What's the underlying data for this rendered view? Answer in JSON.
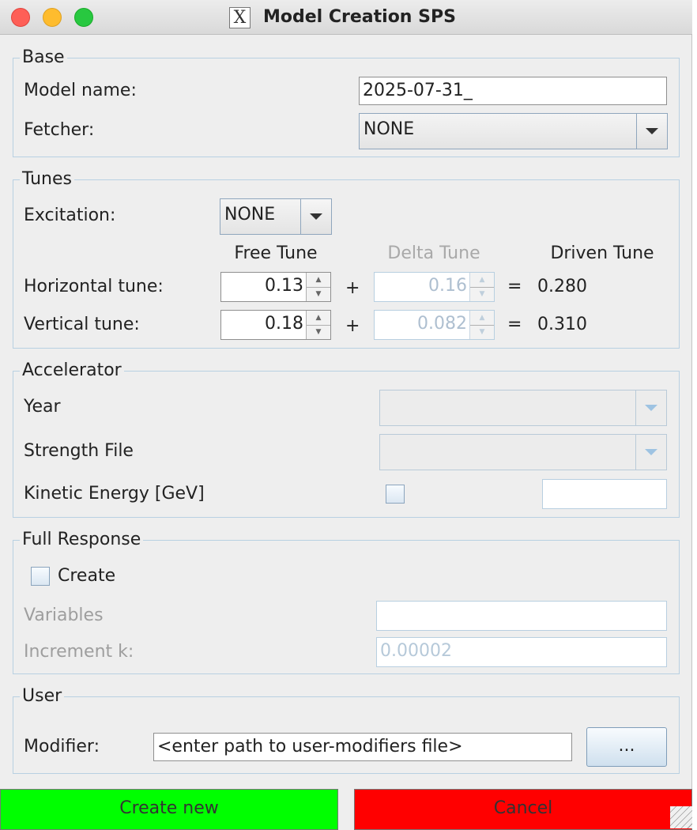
{
  "window": {
    "title": "Model Creation SPS"
  },
  "base": {
    "legend": "Base",
    "model_name_label": "Model name:",
    "model_name_value": "2025-07-31_",
    "fetcher_label": "Fetcher:",
    "fetcher_value": "NONE"
  },
  "tunes": {
    "legend": "Tunes",
    "excitation_label": "Excitation:",
    "excitation_value": "NONE",
    "col_free": "Free Tune",
    "col_delta": "Delta Tune",
    "col_driven": "Driven Tune",
    "plus": "+",
    "equals": "=",
    "horizontal": {
      "label": "Horizontal tune:",
      "free": "0.13",
      "delta": "0.16",
      "driven": "0.280"
    },
    "vertical": {
      "label": "Vertical tune:",
      "free": "0.18",
      "delta": "0.082",
      "driven": "0.310"
    }
  },
  "accelerator": {
    "legend": "Accelerator",
    "year_label": "Year",
    "year_value": "",
    "strength_label": "Strength File",
    "strength_value": "",
    "energy_label": "Kinetic Energy [GeV]",
    "energy_checked": false,
    "energy_value": ""
  },
  "full_response": {
    "legend": "Full Response",
    "create_label": "Create",
    "create_checked": false,
    "variables_label": "Variables",
    "variables_value": "",
    "increment_label": "Increment k:",
    "increment_value": "0.00002"
  },
  "user": {
    "legend": "User",
    "modifier_label": "Modifier:",
    "modifier_value": "<enter path to user-modifiers file>",
    "browse_label": "..."
  },
  "actions": {
    "create_label": "Create new",
    "create_color": "#00ff00",
    "cancel_label": "Cancel",
    "cancel_color": "#ff0000"
  }
}
